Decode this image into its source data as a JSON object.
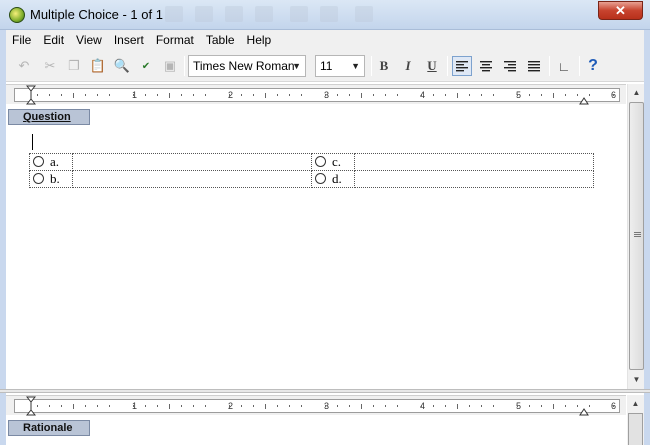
{
  "window": {
    "title": "Multiple Choice - 1 of 1",
    "close_label": "✕"
  },
  "menu": [
    "File",
    "Edit",
    "View",
    "Insert",
    "Format",
    "Table",
    "Help"
  ],
  "toolbar": {
    "font_name": "Times New Roman",
    "font_size": "11",
    "bold_label": "B",
    "italic_label": "I",
    "underline_label": "U",
    "help_label": "?"
  },
  "ruler": {
    "numbers": [
      "1",
      "2",
      "3",
      "4",
      "5",
      "6"
    ]
  },
  "sections": {
    "question_label": "Question",
    "rationale_label": "Rationale"
  },
  "choices": [
    {
      "left": "a.",
      "right": "c."
    },
    {
      "left": "b.",
      "right": "d."
    }
  ]
}
